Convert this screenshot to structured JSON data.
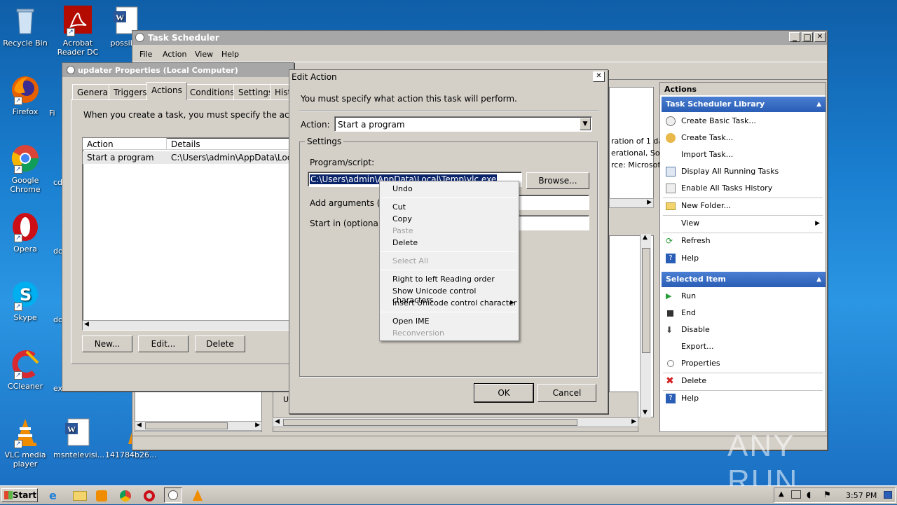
{
  "desktop": {
    "icons": [
      {
        "label": "Recycle Bin"
      },
      {
        "label": "Acrobat Reader DC"
      },
      {
        "label": "possible"
      },
      {
        "label": "Firefox"
      },
      {
        "label": "Fi"
      },
      {
        "label": "Google Chrome"
      },
      {
        "label": "cd"
      },
      {
        "label": "Opera"
      },
      {
        "label": "do"
      },
      {
        "label": "Skype"
      },
      {
        "label": "do"
      },
      {
        "label": "CCleaner"
      },
      {
        "label": "ex"
      },
      {
        "label": "VLC media player"
      },
      {
        "label": "msntelevisi..."
      },
      {
        "label": "141784b26..."
      }
    ]
  },
  "task_scheduler": {
    "title": "Task Scheduler",
    "menu": [
      "File",
      "Action",
      "View",
      "Help"
    ],
    "background_text": {
      "line1": "ration of 1 da",
      "line2": "erational, So",
      "line3": "rce: Microsoft",
      "u": "U"
    },
    "actions_pane": {
      "header": "Actions",
      "section1": "Task Scheduler Library",
      "items1": [
        "Create Basic Task...",
        "Create Task...",
        "Import Task...",
        "Display All Running Tasks",
        "Enable All Tasks History",
        "New Folder...",
        "View",
        "Refresh",
        "Help"
      ],
      "section2": "Selected Item",
      "items2": [
        "Run",
        "End",
        "Disable",
        "Export...",
        "Properties",
        "Delete",
        "Help"
      ]
    }
  },
  "properties_dialog": {
    "title": "updater Properties (Local Computer)",
    "tabs": [
      "General",
      "Triggers",
      "Actions",
      "Conditions",
      "Settings",
      "Hist"
    ],
    "active_tab": "Actions",
    "description": "When you create a task, you must specify the action tha",
    "columns": [
      "Action",
      "Details"
    ],
    "rows": [
      {
        "action": "Start a program",
        "details": "C:\\Users\\admin\\AppData\\Local\\T"
      }
    ],
    "buttons": {
      "new": "New...",
      "edit": "Edit...",
      "delete": "Delete"
    }
  },
  "edit_action": {
    "title": "Edit Action",
    "close": "✕",
    "instruction": "You must specify what action this task will perform.",
    "action_label": "Action:",
    "action_value": "Start a program",
    "settings_label": "Settings",
    "program_label": "Program/script:",
    "program_value": "C:\\Users\\admin\\AppData\\Local\\Temp\\vlc.exe",
    "browse": "Browse...",
    "args_label": "Add arguments (op",
    "start_label": "Start in (optional):",
    "ok": "OK",
    "cancel": "Cancel"
  },
  "context_menu": {
    "undo": "Undo",
    "cut": "Cut",
    "copy": "Copy",
    "paste": "Paste",
    "delete": "Delete",
    "select_all": "Select All",
    "rtl": "Right to left Reading order",
    "show_unicode": "Show Unicode control characters",
    "insert_unicode": "Insert Unicode control character",
    "open_ime": "Open IME",
    "reconversion": "Reconversion"
  },
  "taskbar": {
    "start": "Start",
    "clock": "3:57 PM"
  },
  "watermark": "ANY RUN",
  "colors": {
    "title_active": "#1f4a99",
    "ap_section": "#2a5db5",
    "selection": "#0a246a"
  }
}
